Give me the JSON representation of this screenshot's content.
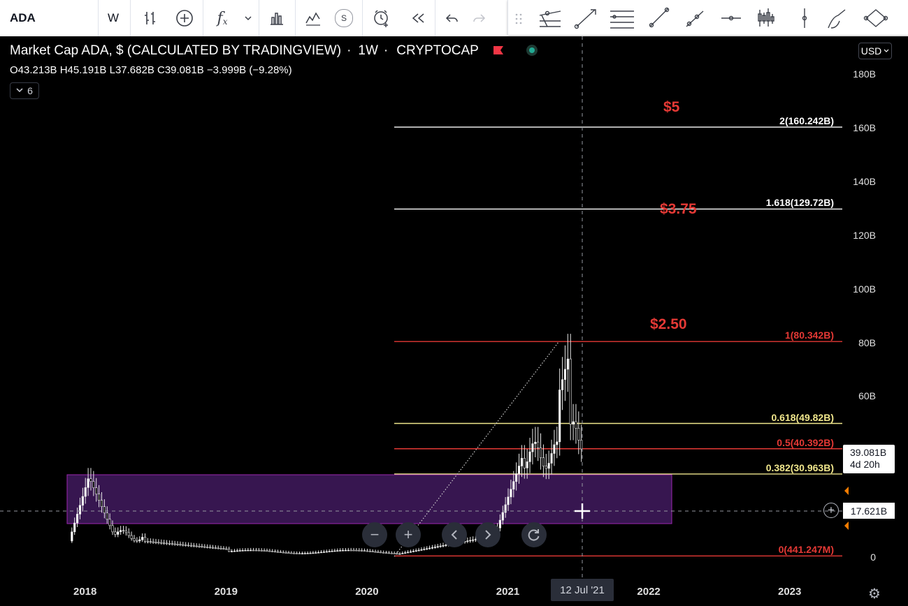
{
  "toolbar": {
    "symbol": "ADA",
    "interval": "W",
    "fx_label": "f",
    "fx_sub": "x",
    "compare_label": "S"
  },
  "legend": {
    "title": "Market Cap ADA, $ (CALCULATED BY TRADINGVIEW)",
    "timeframe": "1W",
    "exchange": "CRYPTOCAP",
    "ohlc": "O43.213B H45.191B L37.682B C39.081B −3.999B (−9.28%)",
    "indicators_count": "6"
  },
  "currency": "USD",
  "price_axis": [
    {
      "label": "180B",
      "value": 180
    },
    {
      "label": "160B",
      "value": 160
    },
    {
      "label": "140B",
      "value": 140
    },
    {
      "label": "120B",
      "value": 120
    },
    {
      "label": "100B",
      "value": 100
    },
    {
      "label": "80B",
      "value": 80
    },
    {
      "label": "60B",
      "value": 60
    },
    {
      "label": "0",
      "value": 0
    }
  ],
  "time_axis": [
    {
      "label": "2018",
      "year": 2018.0
    },
    {
      "label": "2019",
      "year": 2019.0
    },
    {
      "label": "2020",
      "year": 2020.0
    },
    {
      "label": "2021",
      "year": 2021.0
    },
    {
      "label": "2022",
      "year": 2022.0
    },
    {
      "label": "2023",
      "year": 2023.0
    }
  ],
  "fib_levels": [
    {
      "label": "2(160.242B)",
      "value": 160.242,
      "color": "#ffffff"
    },
    {
      "label": "1.618(129.72B)",
      "value": 129.72,
      "color": "#ffffff"
    },
    {
      "label": "1(80.342B)",
      "value": 80.342,
      "color": "#e53935"
    },
    {
      "label": "0.618(49.82B)",
      "value": 49.82,
      "color": "#f0e68c"
    },
    {
      "label": "0.5(40.392B)",
      "value": 40.392,
      "color": "#e53935"
    },
    {
      "label": "0.382(30.963B)",
      "value": 30.963,
      "color": "#f0e68c"
    },
    {
      "label": "0(441.247M)",
      "value": 0.441,
      "color": "#e53935"
    }
  ],
  "price_annotations": [
    {
      "text": "$5",
      "value": 167
    },
    {
      "text": "$3.75",
      "value": 129
    },
    {
      "text": "$2.50",
      "value": 86
    }
  ],
  "current_price": {
    "value": "39.081B",
    "countdown": "4d 20h"
  },
  "crosshair": {
    "price": "17.621B",
    "time": "12 Jul '21"
  },
  "colors": {
    "accent": "#2962ff",
    "zone": "#4a1d6b",
    "fib_red": "#e53935",
    "fib_yellow": "#f0e68c"
  }
}
